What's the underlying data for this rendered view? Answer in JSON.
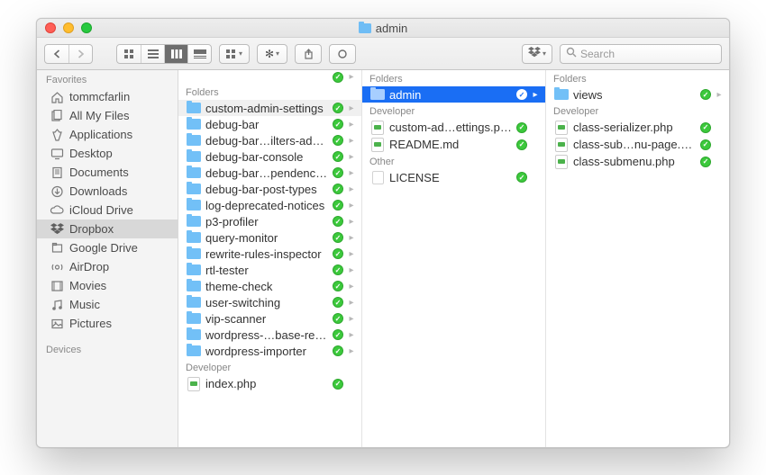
{
  "window": {
    "title": "admin"
  },
  "toolbar": {
    "search_placeholder": "Search"
  },
  "sidebar": {
    "header1": "Favorites",
    "items": [
      {
        "label": "tommcfarlin",
        "icon": "home"
      },
      {
        "label": "All My Files",
        "icon": "all-files"
      },
      {
        "label": "Applications",
        "icon": "apps"
      },
      {
        "label": "Desktop",
        "icon": "desktop"
      },
      {
        "label": "Documents",
        "icon": "documents"
      },
      {
        "label": "Downloads",
        "icon": "downloads"
      },
      {
        "label": "iCloud Drive",
        "icon": "icloud"
      },
      {
        "label": "Dropbox",
        "icon": "dropbox",
        "active": true
      },
      {
        "label": "Google Drive",
        "icon": "gdrive"
      },
      {
        "label": "AirDrop",
        "icon": "airdrop"
      },
      {
        "label": "Movies",
        "icon": "movies"
      },
      {
        "label": "Music",
        "icon": "music"
      },
      {
        "label": "Pictures",
        "icon": "pictures"
      }
    ],
    "header2": "Devices"
  },
  "col1": {
    "groups": [
      {
        "header": "Folders",
        "items": [
          {
            "label": "custom-admin-settings",
            "type": "folder",
            "selected_gray": true
          },
          {
            "label": "debug-bar",
            "type": "folder"
          },
          {
            "label": "debug-bar…ilters-addon",
            "type": "folder"
          },
          {
            "label": "debug-bar-console",
            "type": "folder"
          },
          {
            "label": "debug-bar…pendencies",
            "type": "folder"
          },
          {
            "label": "debug-bar-post-types",
            "type": "folder"
          },
          {
            "label": "log-deprecated-notices",
            "type": "folder"
          },
          {
            "label": "p3-profiler",
            "type": "folder"
          },
          {
            "label": "query-monitor",
            "type": "folder"
          },
          {
            "label": "rewrite-rules-inspector",
            "type": "folder"
          },
          {
            "label": "rtl-tester",
            "type": "folder"
          },
          {
            "label": "theme-check",
            "type": "folder"
          },
          {
            "label": "user-switching",
            "type": "folder"
          },
          {
            "label": "vip-scanner",
            "type": "folder"
          },
          {
            "label": "wordpress-…base-reset",
            "type": "folder"
          },
          {
            "label": "wordpress-importer",
            "type": "folder"
          }
        ]
      },
      {
        "header": "Developer",
        "items": [
          {
            "label": "index.php",
            "type": "php",
            "no_chev": true
          }
        ]
      }
    ]
  },
  "col2": {
    "groups": [
      {
        "header": "Folders",
        "items": [
          {
            "label": "admin",
            "type": "folder",
            "selected": true
          }
        ]
      },
      {
        "header": "Developer",
        "items": [
          {
            "label": "custom-ad…ettings.php",
            "type": "php",
            "no_chev": true
          },
          {
            "label": "README.md",
            "type": "php",
            "no_chev": true
          }
        ]
      },
      {
        "header": "Other",
        "items": [
          {
            "label": "LICENSE",
            "type": "file",
            "no_chev": true
          }
        ]
      }
    ]
  },
  "col3": {
    "groups": [
      {
        "header": "Folders",
        "items": [
          {
            "label": "views",
            "type": "folder"
          }
        ]
      },
      {
        "header": "Developer",
        "items": [
          {
            "label": "class-serializer.php",
            "type": "php",
            "no_chev": true
          },
          {
            "label": "class-sub…nu-page.php",
            "type": "php",
            "no_chev": true
          },
          {
            "label": "class-submenu.php",
            "type": "php",
            "no_chev": true
          }
        ]
      }
    ]
  }
}
